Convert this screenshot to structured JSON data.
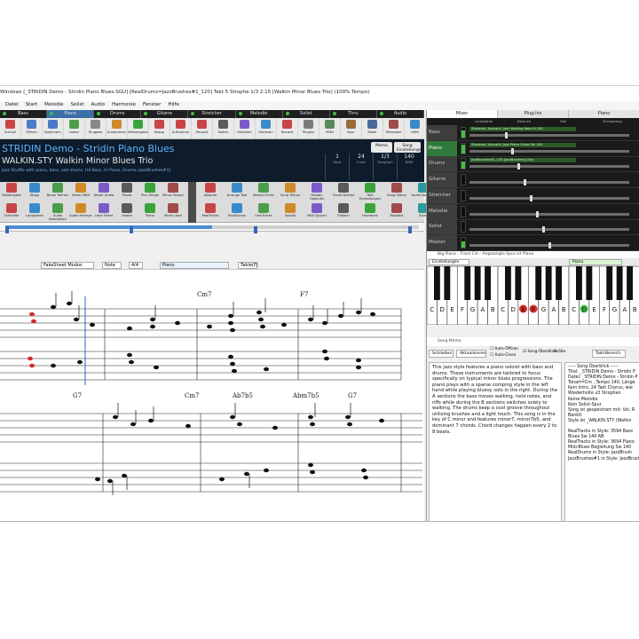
{
  "window": {
    "title": "Windows [_STRIDIN Demo - Stridin Piano Blues.SGU] [RealDrums=JazzBrushes#1_120] Takt 5 Strophe 1/3 2.15 [Walkin Minor Blues Trio] (100% Tempo)"
  },
  "menu": [
    "Datei",
    "Start",
    "Melodie",
    "Solist",
    "Audio",
    "Harmonie",
    "Fenster",
    "Hilfe"
  ],
  "tracks": [
    "Bass",
    "Piano",
    "Drums",
    "Gitarre",
    "Streicher",
    "Melodie",
    "Solist",
    "Thru",
    "Audio"
  ],
  "toolbar1": [
    {
      "label": "Zurück",
      "color": "#c94545"
    },
    {
      "label": "Öffnen",
      "color": "#4a7bc9"
    },
    {
      "label": "Speichern",
      "color": "#4a7bc9"
    },
    {
      "label": "Laden",
      "color": "#4a9e4a"
    },
    {
      "label": "Eingabe",
      "color": "#888888"
    },
    {
      "label": "Zusammen",
      "color": "#d08a2a"
    },
    {
      "label": "Wiedergabe",
      "color": "#3aa43a"
    },
    {
      "label": "Stopp",
      "color": "#c94545"
    },
    {
      "label": "Aufnahme",
      "color": "#c94545"
    },
    {
      "label": "Record",
      "color": "#c94545"
    },
    {
      "label": "Noten",
      "color": "#5a5a5a"
    },
    {
      "label": "Strecken",
      "color": "#7a5ac9"
    },
    {
      "label": "Vorlesen",
      "color": "#3a8ac9"
    },
    {
      "label": "Record",
      "color": "#c94545"
    },
    {
      "label": "Plugins",
      "color": "#7a7a7a"
    },
    {
      "label": "MIDI",
      "color": "#5a8a5a"
    },
    {
      "label": "Spur",
      "color": "#9a6a3a"
    },
    {
      "label": "Mixer",
      "color": "#4a6a9a"
    },
    {
      "label": "Stilmaker",
      "color": "#a04a4a"
    },
    {
      "label": "Hilfe",
      "color": "#3a8ac9"
    }
  ],
  "song": {
    "title": "STRIDIN Demo - Stridin Piano Blues",
    "style": "WALKIN.STY Walkin Minor Blues Trio",
    "style_desc": "Jazz Shuffle with piano, bass, and drums.     [Hi Bass, Hi Piano, Drums=JazzBrushes#1]",
    "btn_memo": "Memo",
    "btn_settings": "Song Einstellungen",
    "counters": [
      {
        "label": "Start",
        "value": "1"
      },
      {
        "label": "Ende",
        "value": "24"
      },
      {
        "label": "Strophen",
        "value": "1/3"
      },
      {
        "label": "BPM",
        "value": "140"
      }
    ],
    "key_row": [
      "Takt",
      "4/4",
      "Tonart",
      "100%"
    ]
  },
  "toolbar2_top": [
    "Wiedergabe",
    "Stopp",
    "Neuer Refrain",
    "Neuer MIDI",
    "Neuer Audio",
    "Pause",
    "Plus Tempo",
    "Minus Tempo"
  ],
  "toolbar2_bottom": [
    "Schneller",
    "Langsamer",
    "Audio Bearbeiten",
    "Audio Harmon",
    "Lead Sheet",
    "Leader",
    "Piano",
    "Mixer Lead"
  ],
  "toolbar3_top": [
    "Akkorde",
    "Arrange Tool",
    "Akkord Funkt.",
    "Song Tempo",
    "Melody Optionen",
    "Chord Builder",
    "Takt Einstellungen",
    "Song Ebene",
    "Audio Notation"
  ],
  "toolbar3_bottom": [
    "RealTracks",
    "RealDrums",
    "UserTracks",
    "Soloist",
    "MIDI Spuren",
    "Einfach",
    "Harmonie",
    "Melodist",
    "Solist"
  ],
  "progress": {
    "position": 0.5
  },
  "notation": {
    "mode_label": "FakeSheet Modus",
    "note_label": "Note",
    "time_sig": "4/4",
    "track_sel": "Piano",
    "table_label": "Table(F)"
  },
  "score_chords": {
    "line1": [
      "Cm7",
      "F7"
    ],
    "line2": [
      "G7",
      "Cm7",
      "Ab7b5",
      "Abm7b5",
      "G7"
    ]
  },
  "right_tabs": [
    "Mixer",
    "Plug-Ins",
    "Piano"
  ],
  "mixer_header": [
    "Lautstärke",
    "Balance",
    "Hall",
    "Schlagzeug"
  ],
  "mixer": [
    {
      "name": "Bass",
      "patch": "Standard, Acoustic, Jazz Walking Bass Hi 140",
      "level": 0.7,
      "selected": false
    },
    {
      "name": "Piano",
      "patch": "Standard, Acoustic, Jazz Piano Comp Sw 140",
      "level": 0.9,
      "selected": true
    },
    {
      "name": "Drums",
      "patch": "JazzBrushes#1_120 [JazzBrushes] (Sw)",
      "level": 0.8,
      "selected": false
    },
    {
      "name": "Gitarre",
      "patch": "",
      "level": 0.0,
      "selected": false
    },
    {
      "name": "Streicher",
      "patch": "",
      "level": 0.0,
      "selected": false
    },
    {
      "name": "Melodie",
      "patch": "",
      "level": 0.0,
      "selected": false
    },
    {
      "name": "Solist",
      "patch": "",
      "level": 0.0,
      "selected": false
    },
    {
      "name": "Master",
      "patch": "",
      "level": 0.6,
      "selected": false
    }
  ],
  "bigpiano": {
    "title": "Big Piano - Track Cm - Angezeigte Spur ist Piano",
    "settings": "Einstellungen",
    "track": "Piano",
    "labels": [
      "C",
      "D",
      "E",
      "F",
      "G",
      "A",
      "B",
      "C",
      "D",
      "E",
      "F",
      "G",
      "A",
      "B",
      "C",
      "D",
      "E",
      "F",
      "G",
      "A",
      "B"
    ]
  },
  "memo": {
    "title": "Song Memo",
    "buttons": [
      "Schließen",
      "Aktualisieren"
    ],
    "check1": "Auto-Öffnen",
    "check2": "Auto-Close",
    "check3": "Song-Überblick",
    "size_label": "Größe",
    "bars_label": "Takt-Bereich",
    "text": "This jazz style features a piano soloist with bass and drums. These instruments are tailored to focus specifically on typical minor blues progressions. The piano plays with a sparse comping style in the left hand while playing bluesy solo in the right. During the A sections the bass moves walking, held notes, and riffs while during the B sections switches solely to walking. The drums keep a cool groove throughout utilizing brushes and a light touch. This song is in the key of C minor and features minor7, minor7b5, and dominant 7 chords. Chord changes happen every 2 to 8 beats.",
    "info": [
      "----- Song Überblick -----",
      "Titel: _STRIDIN Demo - Stridin P",
      "Datei: _STRIDIN Demo - Stridin P",
      "Tonart=Cm , Tempo 140, Länge",
      "Kein Intro. 24 Takt Chorus, wie",
      "Wiederholte x3 Strophen",
      "Keine Melodie",
      "Kein Solist-Spur.",
      "Song ist gespeichert mit: Vol. R",
      "Bank0.",
      "Style ist _WALKIN.STY (Walkin",
      "",
      "RealTracks in Style: 3594 Bass",
      "Blues Sw 140 AB",
      "RealTracks in Style: 3694 Piano",
      "Midi-Blues Begleitung Sw 140",
      "RealDrums in Style: JazzBrush",
      "JazzBrushes#1 in Style: JazzBrushe"
    ]
  }
}
